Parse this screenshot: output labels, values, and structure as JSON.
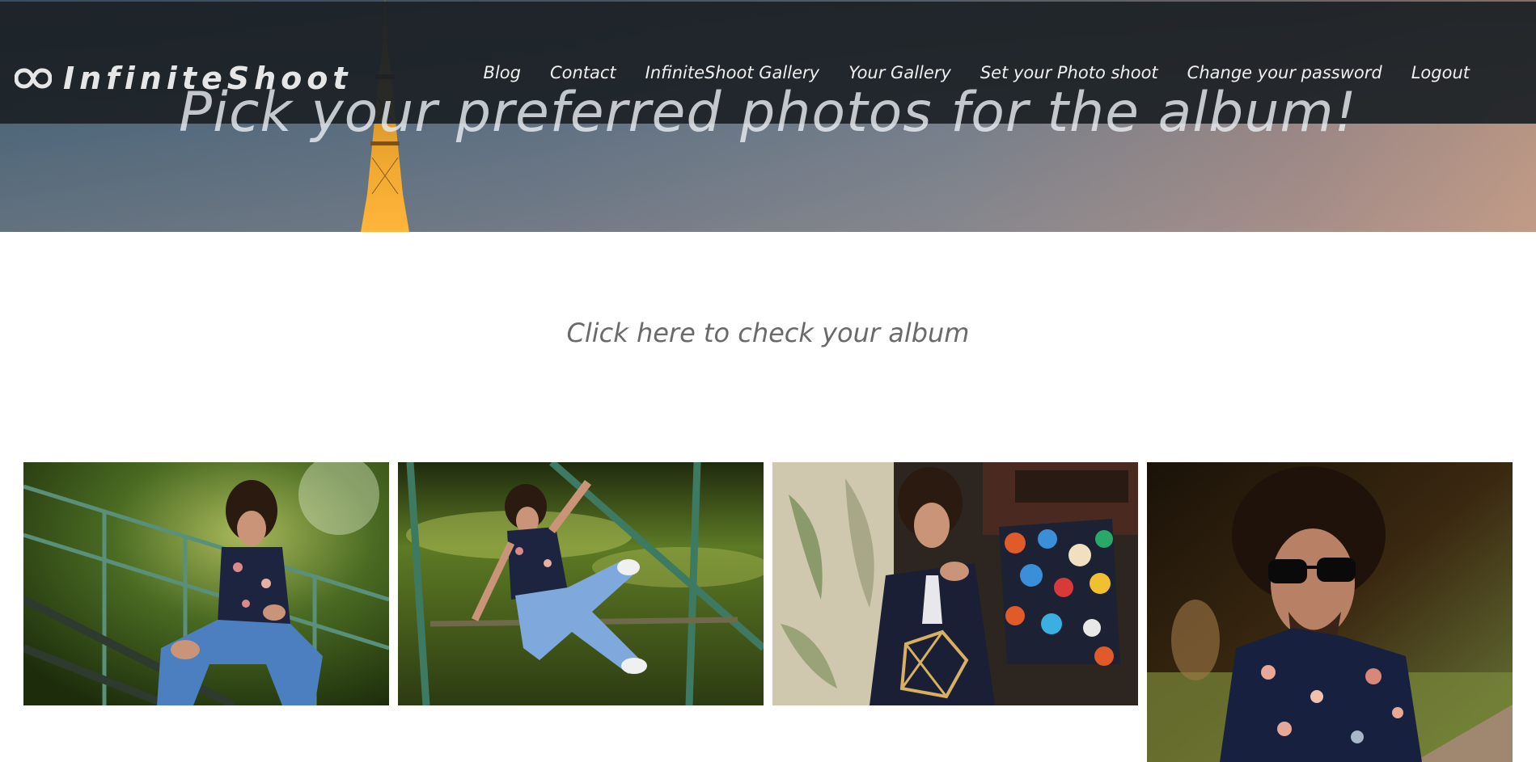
{
  "brand": {
    "name": "InfiniteShoot",
    "icon": "infinity-icon"
  },
  "nav": {
    "items": [
      {
        "label": "Blog"
      },
      {
        "label": "Contact"
      },
      {
        "label": "InfiniteShoot Gallery"
      },
      {
        "label": "Your Gallery"
      },
      {
        "label": "Set your Photo shoot"
      },
      {
        "label": "Change your password"
      },
      {
        "label": "Logout"
      }
    ]
  },
  "hero": {
    "title": "Pick your preferred photos for the album!"
  },
  "album": {
    "link_label": "Click here to check your album"
  },
  "gallery": {
    "photos": [
      {
        "name": "photo-man-on-stairs"
      },
      {
        "name": "photo-man-on-grass"
      },
      {
        "name": "photo-man-with-laptop"
      },
      {
        "name": "photo-man-with-sunglasses"
      }
    ]
  },
  "colors": {
    "navbar": "#1c2126",
    "nav_text": "#efefef",
    "link_text": "#6a6a6a"
  }
}
